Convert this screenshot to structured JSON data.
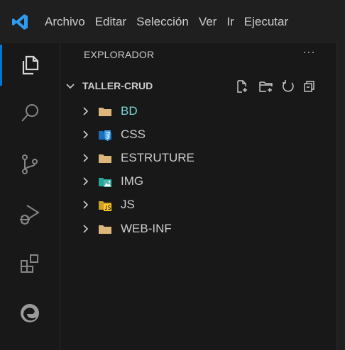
{
  "menu": [
    "Archivo",
    "Editar",
    "Selección",
    "Ver",
    "Ir",
    "Ejecutar"
  ],
  "explorer": {
    "title": "EXPLORADOR",
    "more_label": "···",
    "project": "TALLER-CRUD",
    "folders": [
      {
        "label": "BD",
        "icon": "folder-icon",
        "color": "#dcb67a"
      },
      {
        "label": "CSS",
        "icon": "css-folder-icon",
        "color": "#42a5f5"
      },
      {
        "label": "ESTRUTURE",
        "icon": "folder-icon",
        "color": "#dcb67a"
      },
      {
        "label": "IMG",
        "icon": "images-folder-icon",
        "color": "#26a69a"
      },
      {
        "label": "JS",
        "icon": "js-folder-icon",
        "color": "#ffca28"
      },
      {
        "label": "WEB-INF",
        "icon": "folder-icon",
        "color": "#dcb67a"
      }
    ]
  },
  "colors": {
    "accent": "#0078d4",
    "bd_label": "#7ad4d4"
  }
}
